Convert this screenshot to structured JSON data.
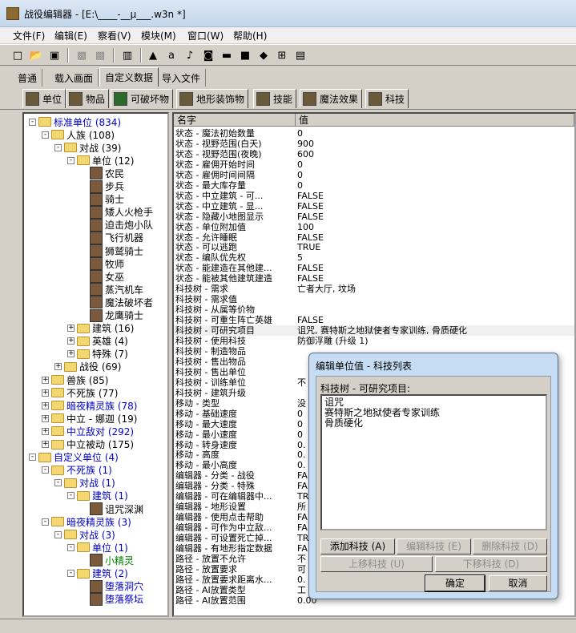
{
  "window": {
    "title": "战役编辑器 - [E:\\____-__µ___.w3n *]"
  },
  "menu": [
    "文件(F)",
    "编辑(E)",
    "察看(V)",
    "模块(M)",
    "窗口(W)",
    "帮助(H)"
  ],
  "tabs_top": [
    {
      "label": "普通"
    },
    {
      "label": "载入画面"
    },
    {
      "label": "自定义数据",
      "active": true
    },
    {
      "label": "导入文件"
    }
  ],
  "tabs_objects": [
    {
      "label": "单位",
      "active": true
    },
    {
      "label": "物品"
    },
    {
      "label": "可破坏物"
    },
    {
      "label": "地形装饰物"
    },
    {
      "label": "技能"
    },
    {
      "label": "魔法效果"
    },
    {
      "label": "科技"
    }
  ],
  "tree": [
    {
      "label": "标准单位",
      "count": "(834)",
      "type": "folder",
      "expander": "-",
      "blue": true
    },
    {
      "label": "人族",
      "count": "(108)",
      "type": "folder",
      "expander": "-"
    },
    {
      "label": "对战",
      "count": "(39)",
      "type": "folder",
      "expander": "-"
    },
    {
      "label": "单位",
      "count": "(12)",
      "type": "folder",
      "expander": "-"
    },
    {
      "label": "农民",
      "type": "unit"
    },
    {
      "label": "步兵",
      "type": "unit"
    },
    {
      "label": "骑士",
      "type": "unit"
    },
    {
      "label": "矮人火枪手",
      "type": "unit"
    },
    {
      "label": "迫击炮小队",
      "type": "unit"
    },
    {
      "label": "飞行机器",
      "type": "unit"
    },
    {
      "label": "狮鹫骑士",
      "type": "unit"
    },
    {
      "label": "牧师",
      "type": "unit"
    },
    {
      "label": "女巫",
      "type": "unit"
    },
    {
      "label": "蒸汽机车",
      "type": "unit"
    },
    {
      "label": "魔法破坏者",
      "type": "unit"
    },
    {
      "label": "龙鹰骑士",
      "type": "unit"
    },
    {
      "label": "建筑",
      "count": "(16)",
      "type": "folder",
      "expander": "+"
    },
    {
      "label": "英雄",
      "count": "(4)",
      "type": "folder",
      "expander": "+"
    },
    {
      "label": "特殊",
      "count": "(7)",
      "type": "folder",
      "expander": "+"
    },
    {
      "label": "战役",
      "count": "(69)",
      "type": "folder",
      "expander": "+"
    },
    {
      "label": "兽族",
      "count": "(85)",
      "type": "folder",
      "expander": "+"
    },
    {
      "label": "不死族",
      "count": "(77)",
      "type": "folder",
      "expander": "+"
    },
    {
      "label": "暗夜精灵族",
      "count": "(78)",
      "type": "folder",
      "expander": "+",
      "blue": true
    },
    {
      "label": "中立 - 娜迦",
      "count": "(19)",
      "type": "folder",
      "expander": "+"
    },
    {
      "label": "中立敌对",
      "count": "(292)",
      "type": "folder",
      "expander": "+",
      "blue": true
    },
    {
      "label": "中立被动",
      "count": "(175)",
      "type": "folder",
      "expander": "+"
    },
    {
      "label": "自定义单位",
      "count": "(4)",
      "type": "folder",
      "expander": "-",
      "blue": true
    },
    {
      "label": "不死族",
      "count": "(1)",
      "type": "folder",
      "expander": "-",
      "blue": true
    },
    {
      "label": "对战",
      "count": "(1)",
      "type": "folder",
      "expander": "-",
      "blue": true
    },
    {
      "label": "建筑",
      "count": "(1)",
      "type": "folder",
      "expander": "-",
      "blue": true
    },
    {
      "label": "诅咒深渊",
      "type": "unit"
    },
    {
      "label": "暗夜精灵族",
      "count": "(3)",
      "type": "folder",
      "expander": "-",
      "blue": true
    },
    {
      "label": "对战",
      "count": "(3)",
      "type": "folder",
      "expander": "-",
      "blue": true
    },
    {
      "label": "单位",
      "count": "(1)",
      "type": "folder",
      "expander": "-",
      "blue": true
    },
    {
      "label": "小精灵",
      "type": "unit",
      "green": true
    },
    {
      "label": "建筑",
      "count": "(2)",
      "type": "folder",
      "expander": "-",
      "blue": true
    },
    {
      "label": "堕落洞穴",
      "type": "unit",
      "blue": true
    },
    {
      "label": "堕落祭坛",
      "type": "unit",
      "blue": true
    }
  ],
  "property_list": {
    "headers": [
      "名字",
      "值"
    ],
    "rows": [
      [
        "状态 - 魔法初始数量",
        "0"
      ],
      [
        "状态 - 视野范围(白天)",
        "900"
      ],
      [
        "状态 - 视野范围(夜晚)",
        "600"
      ],
      [
        "状态 - 雇佣开始时间",
        "0"
      ],
      [
        "状态 - 雇佣时间间隔",
        "0"
      ],
      [
        "状态 - 最大库存量",
        "0"
      ],
      [
        "状态 - 中立建筑 - 可...",
        "FALSE"
      ],
      [
        "状态 - 中立建筑 - 显...",
        "FALSE"
      ],
      [
        "状态 - 隐藏小地图显示",
        "FALSE"
      ],
      [
        "状态 - 单位附加值",
        "100"
      ],
      [
        "状态 - 允许睡眠",
        "FALSE"
      ],
      [
        "状态 - 可以逃跑",
        "TRUE"
      ],
      [
        "状态 - 编队优先权",
        "5"
      ],
      [
        "状态 - 能建造在其他建...",
        "FALSE"
      ],
      [
        "状态 - 能被其他建筑建造",
        "FALSE"
      ],
      [
        "科技树 - 需求",
        "亡者大厅, 坟场"
      ],
      [
        "科技树 - 需求值",
        ""
      ],
      [
        "科技树 - 从属等价物",
        ""
      ],
      [
        "科技树 - 可重生阵亡英雄",
        "FALSE"
      ],
      [
        "科技树 - 可研究项目",
        "诅咒, 赛特斯之地狱使者专家训练, 骨质硬化"
      ],
      [
        "科技树 - 使用科技",
        "防御浮雕 (升级 1)"
      ],
      [
        "科技树 - 制造物品",
        ""
      ],
      [
        "科技树 - 售出物品",
        ""
      ],
      [
        "科技树 - 售出单位",
        ""
      ],
      [
        "科技树 - 训练单位",
        "不"
      ],
      [
        "科技树 - 建筑升级",
        ""
      ],
      [
        "移动 - 类型",
        "没"
      ],
      [
        "移动 - 基础速度",
        "0"
      ],
      [
        "移动 - 最大速度",
        "0"
      ],
      [
        "移动 - 最小速度",
        "0"
      ],
      [
        "移动 - 转身速度",
        "0."
      ],
      [
        "移动 - 高度",
        "0."
      ],
      [
        "移动 - 最小高度",
        "0."
      ],
      [
        "编辑器 - 分类 - 战役",
        "FA"
      ],
      [
        "编辑器 - 分类 - 特殊",
        "FA"
      ],
      [
        "编辑器 - 可在编辑器中...",
        "TR"
      ],
      [
        "编辑器 - 地形设置",
        "所"
      ],
      [
        "编辑器 - 使用点击帮助",
        "FA"
      ],
      [
        "编辑器 - 可作为中立敌...",
        "FA"
      ],
      [
        "编辑器 - 可设置死亡掉...",
        "TR"
      ],
      [
        "编辑器 - 有地形指定数据",
        "FA"
      ],
      [
        "路径 - 放置不允许",
        "不"
      ],
      [
        "路径 - 放置要求",
        "可"
      ],
      [
        "路径 - 放置要求距离水...",
        "0."
      ],
      [
        "路径 - AI放置类型",
        "工"
      ],
      [
        "路径 - AI放置范围",
        "0.00"
      ]
    ]
  },
  "dialog": {
    "title": "编辑单位值 - 科技列表",
    "label": "科技树 - 可研究项目:",
    "items": [
      "诅咒",
      "赛特斯之地狱使者专家训练",
      "骨质硬化"
    ],
    "buttons": {
      "add": "添加科技 (A)",
      "edit": "编辑科技 (E)",
      "delete": "删除科技 (D)",
      "move_up": "上移科技 (U)",
      "move_down": "下移科技 (D)",
      "ok": "确定",
      "cancel": "取消"
    }
  }
}
